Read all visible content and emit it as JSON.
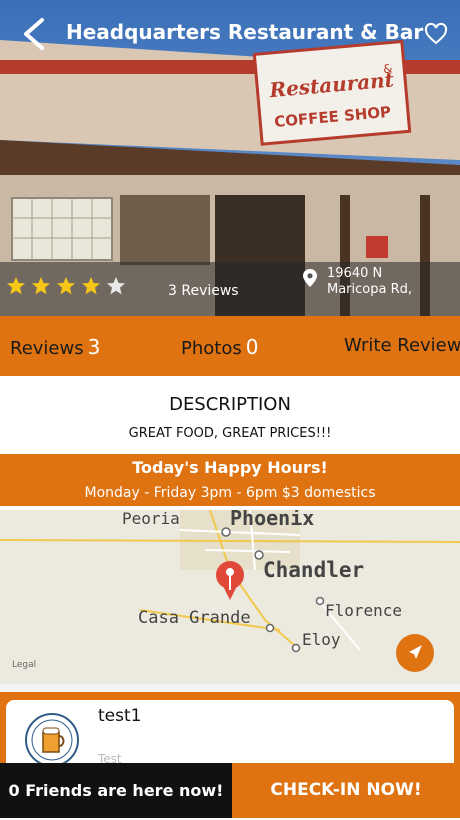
{
  "header": {
    "title": "Headquarters Restaurant & Bar"
  },
  "hero": {
    "sign_line1": "Restaurant",
    "sign_amp": "&",
    "sign_line2": "COFFEE SHOP",
    "rating_value": 4,
    "rating_max": 5,
    "reviews_text": "3 Reviews",
    "address_line1": "19640 N",
    "address_line2": "Maricopa Rd,"
  },
  "tabs": [
    {
      "label": "Reviews",
      "count": "3"
    },
    {
      "label": "Photos",
      "count": "0"
    },
    {
      "label": "Write Review"
    }
  ],
  "description": {
    "heading": "DESCRIPTION",
    "text": "GREAT FOOD, GREAT PRICES!!!"
  },
  "happy_hours": {
    "heading": "Today's Happy Hours!",
    "detail": "Monday - Friday 3pm - 6pm $3 domestics"
  },
  "map": {
    "labels": [
      "Peoria",
      "Phoenix",
      "Chandler",
      "Casa Grande",
      "Florence",
      "Eloy"
    ],
    "legal": "Legal"
  },
  "review": {
    "user": "test1",
    "text": "Test"
  },
  "bottom": {
    "friends": "0 Friends are here now!",
    "checkin": "CHECK-IN NOW!"
  },
  "colors": {
    "accent": "#df7311",
    "dark": "#111111"
  }
}
